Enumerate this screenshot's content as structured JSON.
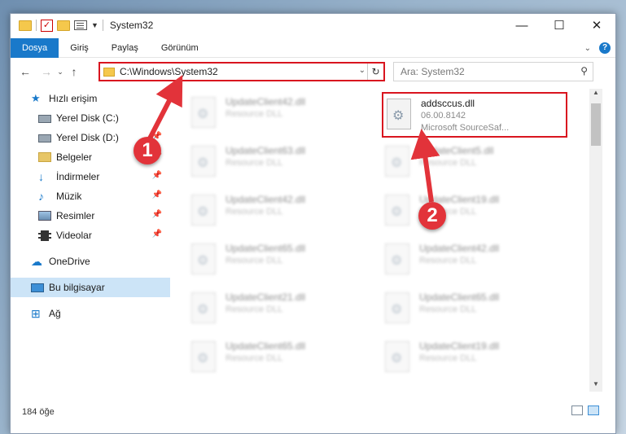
{
  "window": {
    "title": "System32",
    "controls": {
      "minimize": "—",
      "maximize": "☐",
      "close": "✕"
    }
  },
  "ribbon": {
    "tabs": [
      "Dosya",
      "Giriş",
      "Paylaş",
      "Görünüm"
    ],
    "collapse": "⌄",
    "help": "?"
  },
  "nav": {
    "back": "←",
    "forward": "→",
    "recent": "⌄",
    "up": "↑",
    "address": "C:\\Windows\\System32",
    "address_dropdown": "⌄",
    "refresh": "↻",
    "search_placeholder": "Ara: System32",
    "search_icon": "⚲"
  },
  "sidebar": {
    "quick_access": "Hızlı erişim",
    "items": [
      {
        "label": "Yerel Disk (C:)",
        "icon": "disk-icon",
        "pinned": true
      },
      {
        "label": "Yerel Disk (D:)",
        "icon": "disk-icon",
        "pinned": true
      },
      {
        "label": "Belgeler",
        "icon": "documents-icon",
        "pinned": true
      },
      {
        "label": "İndirmeler",
        "icon": "download-icon",
        "pinned": true
      },
      {
        "label": "Müzik",
        "icon": "music-icon",
        "pinned": true
      },
      {
        "label": "Resimler",
        "icon": "pictures-icon",
        "pinned": true
      },
      {
        "label": "Videolar",
        "icon": "videos-icon",
        "pinned": true
      }
    ],
    "onedrive": "OneDrive",
    "this_pc": "Bu bilgisayar",
    "network": "Ağ",
    "pin_glyph": "📌"
  },
  "files": {
    "left_column": [
      {
        "name": "UpdateClient42.dll",
        "type": "Resource DLL"
      },
      {
        "name": "UpdateClient63.dll",
        "type": "Resource DLL"
      },
      {
        "name": "UpdateClient42.dll",
        "type": "Resource DLL"
      },
      {
        "name": "UpdateClient65.dll",
        "type": "Resource DLL"
      },
      {
        "name": "UpdateClient21.dll",
        "type": "Resource DLL"
      },
      {
        "name": "UpdateClient65.dll",
        "type": "Resource DLL"
      }
    ],
    "highlighted": {
      "name": "addsccus.dll",
      "version": "06.00.8142",
      "description": "Microsoft SourceSaf..."
    },
    "right_column": [
      {
        "name": "UpdateClient5.dll",
        "type": "Resource DLL"
      },
      {
        "name": "UpdateClient19.dll",
        "type": "Resource DLL"
      },
      {
        "name": "UpdateClient42.dll",
        "type": "Resource DLL"
      },
      {
        "name": "UpdateClient65.dll",
        "type": "Resource DLL"
      },
      {
        "name": "UpdateClient19.dll",
        "type": "Resource DLL"
      }
    ]
  },
  "status": {
    "item_count": "184 öğe"
  },
  "annotations": {
    "callout1": "1",
    "callout2": "2",
    "color": "#e2333a"
  }
}
